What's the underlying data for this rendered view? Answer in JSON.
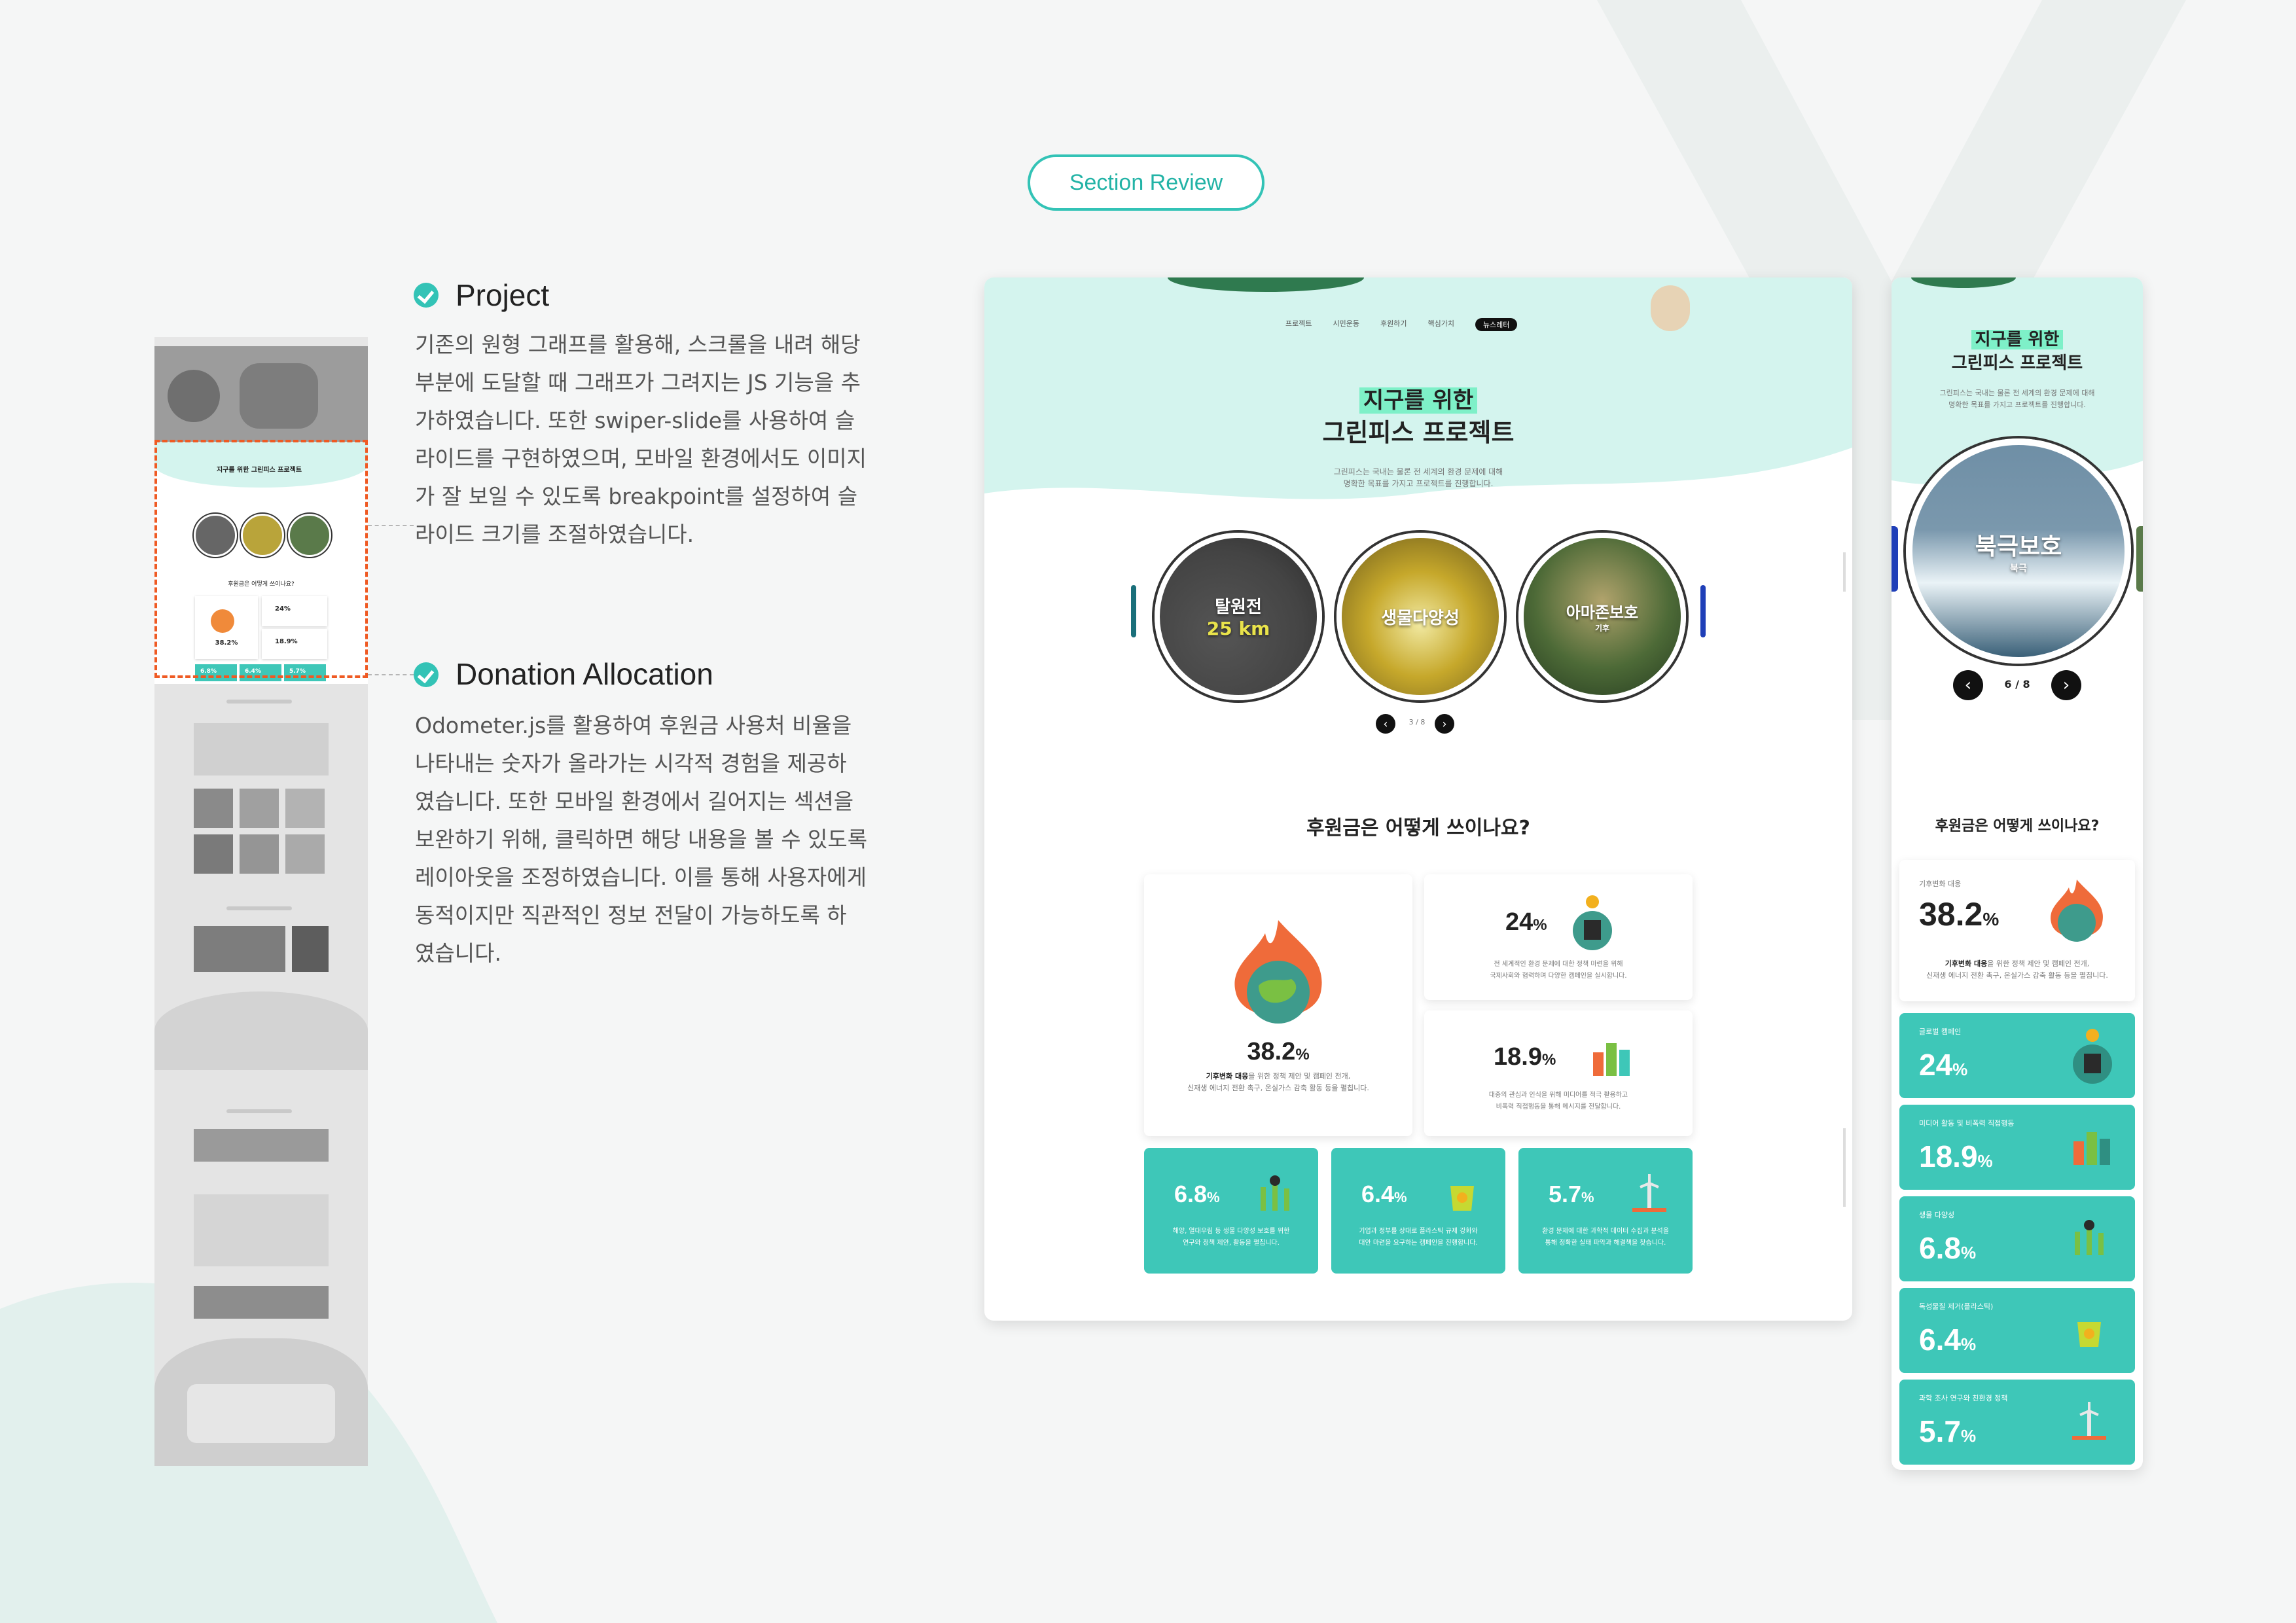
{
  "pill_label": "Section Review",
  "project": {
    "title": "Project",
    "body": "기존의 원형 그래프를 활용해, 스크롤을 내려 해당\n부분에 도달할 때 그래프가 그려지는 JS 기능을 추\n가하였습니다. 또한 swiper-slide를 사용하여 슬\n라이드를 구현하였으며, 모바일 환경에서도 이미지\n가 잘 보일 수 있도록 breakpoint를 설정하여 슬\n라이드 크기를 조절하였습니다."
  },
  "donation": {
    "title": "Donation Allocation",
    "body": "Odometer.js를 활용하여 후원금 사용처 비율을\n나타내는 숫자가 올라가는 시각적 경험을 제공하\n였습니다. 또한 모바일 환경에서 길어지는 섹션을\n보완하기 위해, 클릭하면 해당 내용을 볼 수 있도록\n레이아웃을 조정하였습니다. 이를 통해 사용자에게\n동적이지만 직관적인 정보 전달이 가능하도록 하\n였습니다."
  },
  "desktop": {
    "nav": [
      "프로젝트",
      "시민운동",
      "후원하기",
      "핵심가치",
      "뉴스레터"
    ],
    "hero_title_1": "지구를 위한",
    "hero_title_2": "그린피스 프로젝트",
    "hero_desc_1": "그린피스는 국내는 물론 전 세계의 환경 문제에 대해",
    "hero_desc_2": "명확한 목표를 가지고 프로젝트를 진행합니다.",
    "slides": [
      {
        "label": "탈원전",
        "sub": "",
        "badge": "25 km"
      },
      {
        "label": "생물다양성",
        "sub": ""
      },
      {
        "label": "아마존보호",
        "sub": "기후"
      }
    ],
    "pager": "3 / 8",
    "donation_heading": "후원금은 어떻게 쓰이나요?",
    "big_card": {
      "value": "38.2",
      "unit": "%",
      "line1_bold": "기후변화 대응",
      "line1": "을 위한 정책 제안 및 캠페인 전개,",
      "line2": "신재생 에너지 전환 촉구, 온실가스 감축 활동 등을 펼칩니다."
    },
    "card_24": {
      "value": "24",
      "unit": "%",
      "line1": "전 세계적인 환경 문제에 대한 정책 마련을 위해",
      "line2": "국제사회와 협력하며 다양한 캠페인을 실시합니다."
    },
    "card_189": {
      "value": "18.9",
      "unit": "%",
      "line1": "대중의 관심과 인식을 위해 미디어를 적극 활용하고",
      "line2": "비폭력 직접행동을 통해 메시지를 전달합니다."
    },
    "teal_cards": [
      {
        "value": "6.8",
        "unit": "%",
        "line1": "해양, 열대우림 등 생물 다양성 보호를 위한",
        "line2": "연구와 정책 제안, 활동을 펼칩니다."
      },
      {
        "value": "6.4",
        "unit": "%",
        "line1": "기업과 정부를 상대로 플라스틱 규제 강화와",
        "line2": "대안 마련을 요구하는 캠페인을 진행합니다."
      },
      {
        "value": "5.7",
        "unit": "%",
        "line1": "환경 문제에 대한 과학적 데이터 수집과 분석을",
        "line2": "통해 정확한 실태 파악과 해결책을 찾습니다."
      }
    ]
  },
  "mobile": {
    "hero_title_1": "지구를 위한",
    "hero_title_2": "그린피스 프로젝트",
    "hero_desc_1": "그린피스는 국내는 물론 전 세계의 환경 문제에 대해",
    "hero_desc_2": "명확한 목표를 가지고 프로젝트를 진행합니다.",
    "slide_label": "북극보호",
    "slide_sub": "북극",
    "pager": "6 / 8",
    "donation_heading": "후원금은 어떻게 쓰이나요?",
    "big_card": {
      "label": "기후변화 대응",
      "value": "38.2",
      "unit": "%",
      "line1_bold": "기후변화 대응",
      "line1": "을 위한 정책 제안 및 캠페인 전개,",
      "line2": "신재생 에너지 전환 촉구, 온실가스 감축 활동 등을 펼칩니다."
    },
    "teal_cards": [
      {
        "label": "글로벌 캠페인",
        "value": "24",
        "unit": "%"
      },
      {
        "label": "미디어 활동 및 비폭력 직접행동",
        "value": "18.9",
        "unit": "%"
      },
      {
        "label": "생물 다양성",
        "value": "6.8",
        "unit": "%"
      },
      {
        "label": "독성물질 제거(플라스틱)",
        "value": "6.4",
        "unit": "%"
      },
      {
        "label": "과학 조사 연구와 친환경 정책",
        "value": "5.7",
        "unit": "%"
      }
    ]
  },
  "thumbnail": {
    "hero_text": "지구를 위한 그린피스 프로젝트",
    "donation_heading": "후원금은 어떻게 쓰이나요?",
    "stats": [
      "38.2%",
      "24%",
      "18.9%",
      "6.8%",
      "6.4%",
      "5.7%"
    ]
  },
  "colors": {
    "teal": "#3ec7b8",
    "accent_orange": "#ef5a23",
    "mint": "#d4f4ee",
    "highlight": "#7ef0c8"
  }
}
